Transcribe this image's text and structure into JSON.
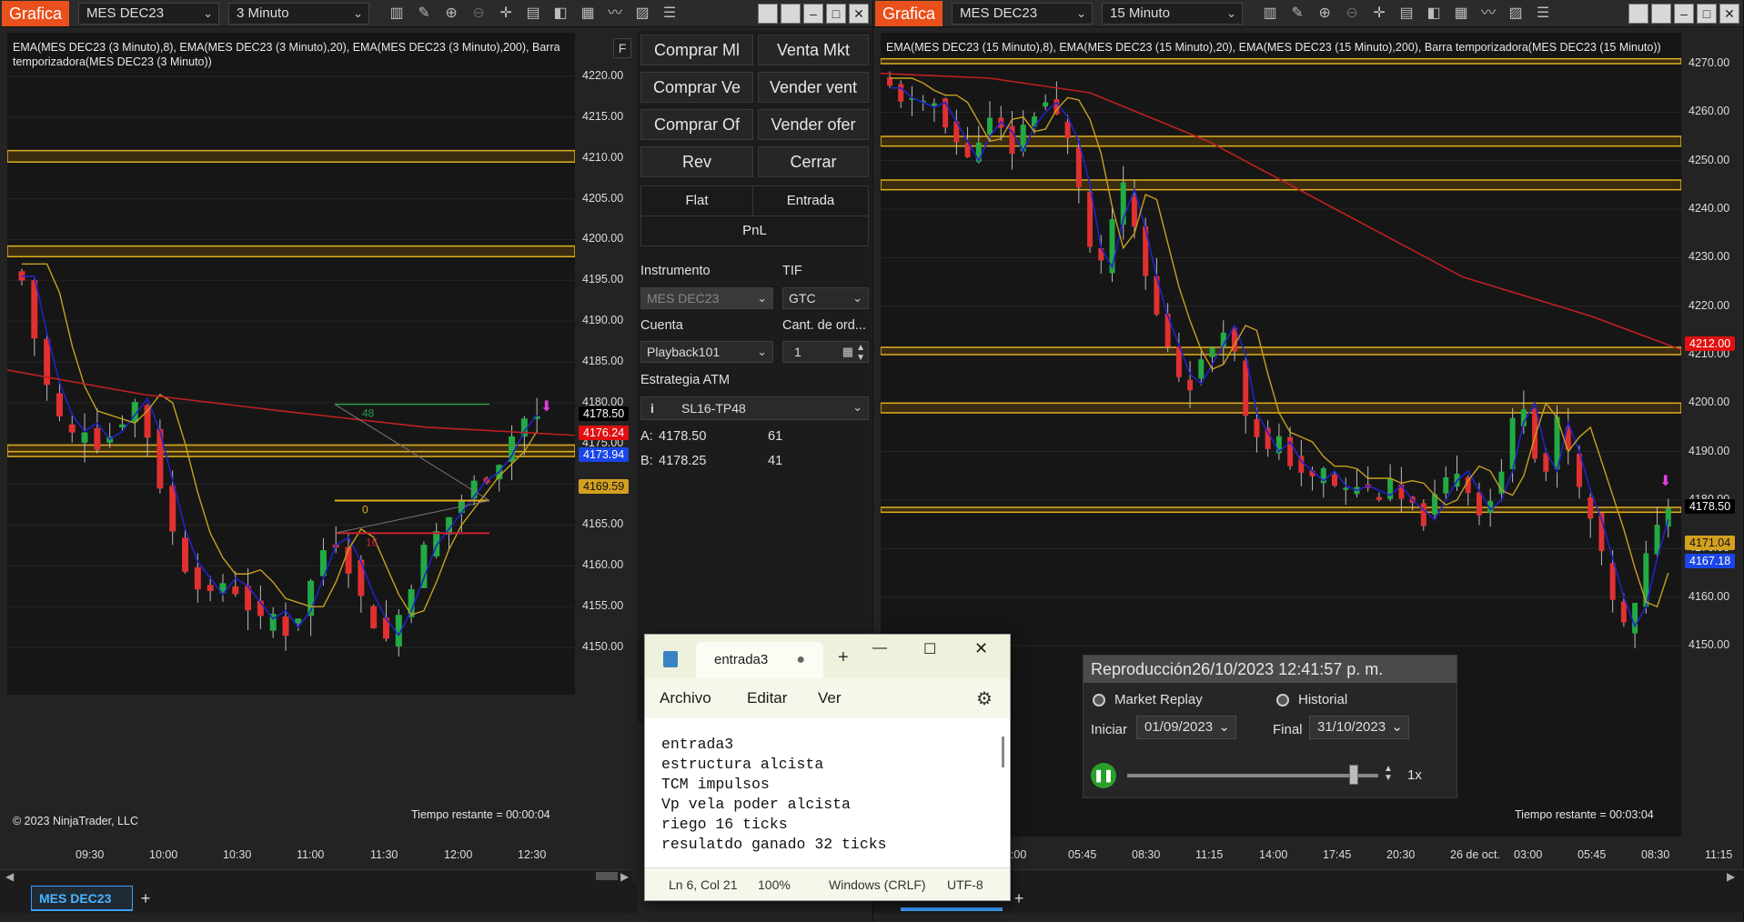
{
  "left_chart": {
    "title": "Grafica",
    "instrument": "MES DEC23",
    "interval": "3 Minuto",
    "indicator_text": "EMA(MES DEC23 (3 Minuto),8), EMA(MES DEC23 (3 Minuto),20), EMA(MES DEC23 (3 Minuto),200), Barra temporizadora(MES DEC23 (3 Minuto))",
    "y_labels": [
      "4220.00",
      "4215.00",
      "4210.00",
      "4205.00",
      "4200.00",
      "4195.00",
      "4190.00",
      "4185.00",
      "4180.00",
      "4175.00",
      "4170.00",
      "4165.00",
      "4160.00",
      "4155.00",
      "4150.00"
    ],
    "x_labels": [
      "09:30",
      "10:00",
      "10:30",
      "11:00",
      "11:30",
      "12:00",
      "12:30"
    ],
    "price_tags": [
      {
        "text": "4178.50",
        "bg": "#000000",
        "fg": "#ffffff"
      },
      {
        "text": "4176.24",
        "bg": "#e01010",
        "fg": "#ffffff"
      },
      {
        "text": "4173.94",
        "bg": "#1a46e8",
        "fg": "#ffffff"
      },
      {
        "text": "4169.59",
        "bg": "#d4a020",
        "fg": "#111111"
      }
    ],
    "drawing_labels": [
      "48",
      "0",
      "16"
    ],
    "copyright": "© 2023 NinjaTrader, LLC",
    "time_left": "Tiempo restante = 00:00:04",
    "side_tab": "F"
  },
  "right_chart": {
    "title": "Grafica",
    "instrument": "MES DEC23",
    "interval": "15 Minuto",
    "indicator_text": "EMA(MES DEC23 (15 Minuto),8), EMA(MES DEC23 (15 Minuto),20), EMA(MES DEC23 (15 Minuto),200), Barra temporizadora(MES DEC23 (15 Minuto))",
    "y_labels": [
      "4270.00",
      "4260.00",
      "4250.00",
      "4240.00",
      "4230.00",
      "4220.00",
      "4210.00",
      "4200.00",
      "4190.00",
      "4180.00",
      "4170.00",
      "4160.00",
      "4150.00"
    ],
    "x_labels": [
      "3:00",
      "05:45",
      "08:30",
      "11:15",
      "14:00",
      "17:45",
      "20:30",
      "26 de oct.",
      "03:00",
      "05:45",
      "08:30",
      "11:15"
    ],
    "price_tags": [
      {
        "text": "4212.00",
        "bg": "#e01010",
        "fg": "#ffffff"
      },
      {
        "text": "4178.50",
        "bg": "#000000",
        "fg": "#ffffff"
      },
      {
        "text": "4171.04",
        "bg": "#d4a020",
        "fg": "#111111"
      },
      {
        "text": "4167.18",
        "bg": "#1a46e8",
        "fg": "#ffffff"
      }
    ],
    "time_left": "Tiempo restante = 00:03:04"
  },
  "order_panel": {
    "buy_market": "Comprar Ml",
    "sell_market": "Venta Mkt",
    "buy_bid": "Comprar Ve",
    "sell_bid": "Vender vent",
    "buy_ask": "Comprar Of",
    "sell_ask": "Vender ofer",
    "rev": "Rev",
    "close": "Cerrar",
    "flat": "Flat",
    "entry": "Entrada",
    "pnl": "PnL",
    "instrument_label": "Instrumento",
    "tif_label": "TIF",
    "instrument_value": "MES DEC23",
    "tif_value": "GTC",
    "account_label": "Cuenta",
    "qty_label": "Cant. de ord...",
    "account_value": "Playback101",
    "qty_value": "1",
    "atm_label": "Estrategia ATM",
    "atm_value": "SL16-TP48",
    "ask_label": "A:",
    "ask_price": "4178.50",
    "ask_size": "61",
    "bid_label": "B:",
    "bid_price": "4178.25",
    "bid_size": "41"
  },
  "notepad": {
    "tab_title": "entrada3",
    "menu": [
      "Archivo",
      "Editar",
      "Ver"
    ],
    "content": "entrada3\nestructura alcista\nTCM impulsos\nVp vela poder alcista\nriego 16 ticks\nresulatdo ganado 32 ticks",
    "status": {
      "position": "Ln 6, Col 21",
      "zoom": "100%",
      "eol": "Windows (CRLF)",
      "encoding": "UTF-8"
    }
  },
  "replay": {
    "title": "Reproducción",
    "datetime": "26/10/2023 12:41:57 p. m.",
    "market_replay": "Market Replay",
    "historial": "Historial",
    "start_label": "Iniciar",
    "start_value": "01/09/2023",
    "end_label": "Final",
    "end_value": "31/10/2023",
    "speed": "1x"
  },
  "tabs": {
    "left_tab": "MES DEC23"
  },
  "colors": {
    "accent_orange": "#e8501c",
    "ema8": "#2222cc",
    "ema20": "#c8a020",
    "ema200": "#c02020",
    "bull": "#22aa44",
    "bear": "#e03030",
    "level": "#e0b020"
  }
}
